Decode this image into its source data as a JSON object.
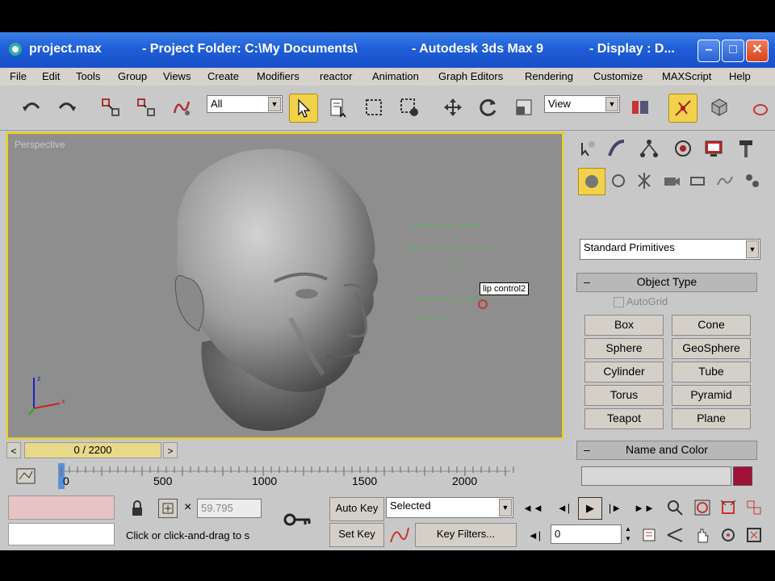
{
  "titlebar": {
    "file": "project.max",
    "folder": "- Project Folder: C:\\My Documents\\",
    "app": "- Autodesk 3ds Max 9",
    "display": "- Display : D..."
  },
  "menu": [
    "File",
    "Edit",
    "Tools",
    "Group",
    "Views",
    "Create",
    "Modifiers",
    "reactor",
    "Animation",
    "Graph Editors",
    "Rendering",
    "Customize",
    "MAXScript",
    "Help"
  ],
  "toolbar": {
    "selection_filter": "All",
    "ref_coord": "View"
  },
  "viewport": {
    "label": "Perspective",
    "tooltip": "lip control2"
  },
  "command_panel": {
    "category": "Standard Primitives",
    "object_type_title": "Object Type",
    "autogrid": "AutoGrid",
    "primitives": [
      "Box",
      "Cone",
      "Sphere",
      "GeoSphere",
      "Cylinder",
      "Tube",
      "Torus",
      "Pyramid",
      "Teapot",
      "Plane"
    ],
    "name_color_title": "Name and Color",
    "object_color": "#a01038"
  },
  "timeline": {
    "frame": "0 / 2200",
    "ticks": [
      "0",
      "500",
      "1000",
      "1500",
      "2000"
    ]
  },
  "status": {
    "x_value": "59.795",
    "prompt": "Click or click-and-drag to s",
    "auto_key": "Auto Key",
    "set_key": "Set Key",
    "key_mode": "Selected",
    "key_filters": "Key Filters...",
    "current_frame": "0"
  }
}
